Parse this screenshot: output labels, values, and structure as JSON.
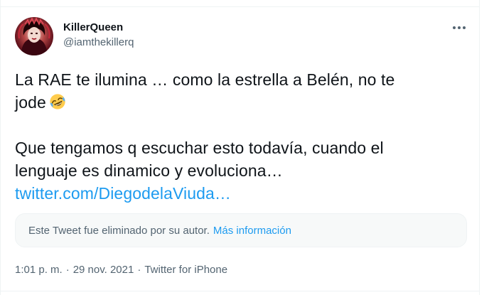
{
  "author": {
    "display_name": "KillerQueen",
    "handle": "@iamthekillerq"
  },
  "tweet": {
    "line1": "La RAE te ilumina … como la estrella a Belén, no te",
    "line2": "jode",
    "emoji": "rolling-on-the-floor-laughing-emoji",
    "line3": "Que tengamos q escuchar esto todavía, cuando el",
    "line4": "lenguaje es dinamico y evoluciona…",
    "link": "twitter.com/DiegodelaViuda…"
  },
  "deleted_notice": {
    "text": "Este Tweet fue eliminado por su autor.",
    "more_info": "Más información"
  },
  "meta": {
    "time": "1:01 p. m.",
    "separator": "·",
    "date": "29 nov. 2021",
    "source": "Twitter for iPhone"
  },
  "colors": {
    "text": "#0f1419",
    "secondary": "#536471",
    "link": "#1d9bf0",
    "border": "#eff3f4",
    "notice_bg": "#f7f9f9"
  }
}
